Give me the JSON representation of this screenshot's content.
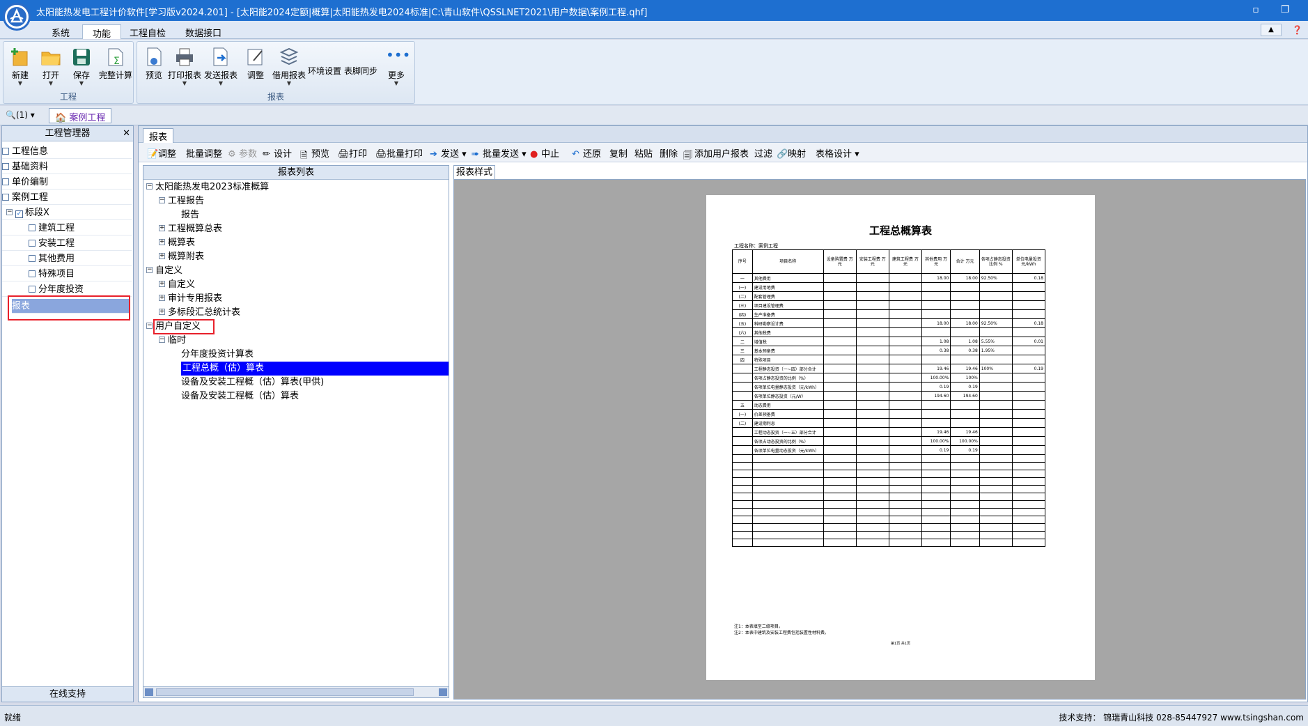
{
  "window": {
    "title": "太阳能热发电工程计价软件[学习版v2024.201] - [太阳能2024定额|概算|太阳能热发电2024标准|C:\\青山软件\\QSSLNET2021\\用户数据\\案例工程.qhf]",
    "restore_icon": "restore-icon",
    "maximize_icon": "maximize-icon"
  },
  "ribbon": {
    "tabs": [
      "系统",
      "功能",
      "工程自检",
      "数据接口"
    ],
    "active_tab": "功能",
    "groups": [
      {
        "label": "工程",
        "buttons": [
          "新建",
          "打开",
          "保存",
          "完整计算"
        ]
      },
      {
        "label": "报表",
        "buttons": [
          "预览",
          "打印报表",
          "发送报表",
          "调整",
          "借用报表",
          "环境设置",
          "表脚同步",
          "更多"
        ]
      }
    ]
  },
  "docbar": {
    "search_count": "(1)",
    "doc_tab": "案例工程"
  },
  "left_panel": {
    "title": "工程管理器",
    "items": [
      "工程信息",
      "基础资料",
      "单价编制",
      "案例工程",
      "标段X",
      "建筑工程",
      "安装工程",
      "其他费用",
      "特殊项目",
      "分年度投资",
      "报表"
    ],
    "footer": "在线支持"
  },
  "main": {
    "tab": "报表",
    "toolbar": [
      "调整",
      "批量调整",
      "参数",
      "设计",
      "预览",
      "打印",
      "批量打印",
      "发送",
      "批量发送",
      "中止",
      "还原",
      "复制",
      "粘贴",
      "删除",
      "添加用户报表",
      "过滤",
      "映射",
      "表格设计"
    ],
    "report_list_title": "报表列表",
    "report_tree": [
      "太阳能热发电2023标准概算",
      "工程报告",
      "报告",
      "工程概算总表",
      "概算表",
      "概算附表",
      "自定义",
      "自定义",
      "审计专用报表",
      "多标段汇总统计表",
      "用户自定义",
      "临时",
      "分年度投资计算表",
      "工程总概（估）算表",
      "设备及安装工程概（估）算表(甲供)",
      "设备及安装工程概（估）算表"
    ],
    "preview_tab": "报表样式"
  },
  "report": {
    "title": "工程总概算表",
    "project_line": "工程名称：案例工程",
    "headers": [
      "序号",
      "项目名称",
      "设备购置费 万元",
      "安装工程费 万元",
      "建筑工程费 万元",
      "其他费用 万元",
      "合计 万元",
      "各项占静态投资比例 %",
      "单位电量投资 元/kWh"
    ],
    "rows": [
      [
        "一",
        "其他费用",
        "",
        "",
        "",
        "18.00",
        "18.00",
        "92.50%",
        "0.18"
      ],
      [
        "(一)",
        "建设用地费",
        "",
        "",
        "",
        "",
        "",
        "",
        ""
      ],
      [
        "(二)",
        "配套管理费",
        "",
        "",
        "",
        "",
        "",
        "",
        ""
      ],
      [
        "(三)",
        "项目建设管理费",
        "",
        "",
        "",
        "",
        "",
        "",
        ""
      ],
      [
        "(四)",
        "生产准备费",
        "",
        "",
        "",
        "",
        "",
        "",
        ""
      ],
      [
        "(五)",
        "科研勘察设计费",
        "",
        "",
        "",
        "18.00",
        "18.00",
        "92.50%",
        "0.18"
      ],
      [
        "(六)",
        "其他税费",
        "",
        "",
        "",
        "",
        "",
        "",
        ""
      ],
      [
        "二",
        "增值税",
        "",
        "",
        "",
        "1.08",
        "1.08",
        "5.55%",
        "0.01"
      ],
      [
        "三",
        "基本预备费",
        "",
        "",
        "",
        "0.38",
        "0.38",
        "1.95%",
        ""
      ],
      [
        "四",
        "特殊项目",
        "",
        "",
        "",
        "",
        "",
        "",
        ""
      ],
      [
        "",
        "工程静态投资（一~四）部分合计",
        "",
        "",
        "",
        "19.46",
        "19.46",
        "100%",
        "0.19"
      ],
      [
        "",
        "各项占静态投资的比例（%）",
        "",
        "",
        "",
        "100.00%",
        "100%",
        "",
        ""
      ],
      [
        "",
        "各项单位电量静态投资（元/kWh）",
        "",
        "",
        "",
        "0.19",
        "0.19",
        "",
        ""
      ],
      [
        "",
        "各项单位静态投资（元/W）",
        "",
        "",
        "",
        "194.60",
        "194.60",
        "",
        ""
      ],
      [
        "五",
        "动态费用",
        "",
        "",
        "",
        "",
        "",
        "",
        ""
      ],
      [
        "(一)",
        "价差预备费",
        "",
        "",
        "",
        "",
        "",
        "",
        ""
      ],
      [
        "(二)",
        "建设期利息",
        "",
        "",
        "",
        "",
        "",
        "",
        ""
      ],
      [
        "",
        "工程动态投资（一~五）部分合计",
        "",
        "",
        "",
        "19.46",
        "19.46",
        "",
        ""
      ],
      [
        "",
        "各项占动态投资的比例（%）",
        "",
        "",
        "",
        "100.00%",
        "100.00%",
        "",
        ""
      ],
      [
        "",
        "各项单位电量动态投资（元/kWh）",
        "",
        "",
        "",
        "0.19",
        "0.19",
        "",
        ""
      ]
    ],
    "notes": [
      "注1：本表填至二级项目。",
      "注2：本表中建筑及安装工程费包括装置性材料费。"
    ],
    "page": "第1页 共1页"
  },
  "status": {
    "left": "就绪",
    "right": "技术支持：  锦瑞青山科技 028-85447927 www.tsingshan.com"
  }
}
